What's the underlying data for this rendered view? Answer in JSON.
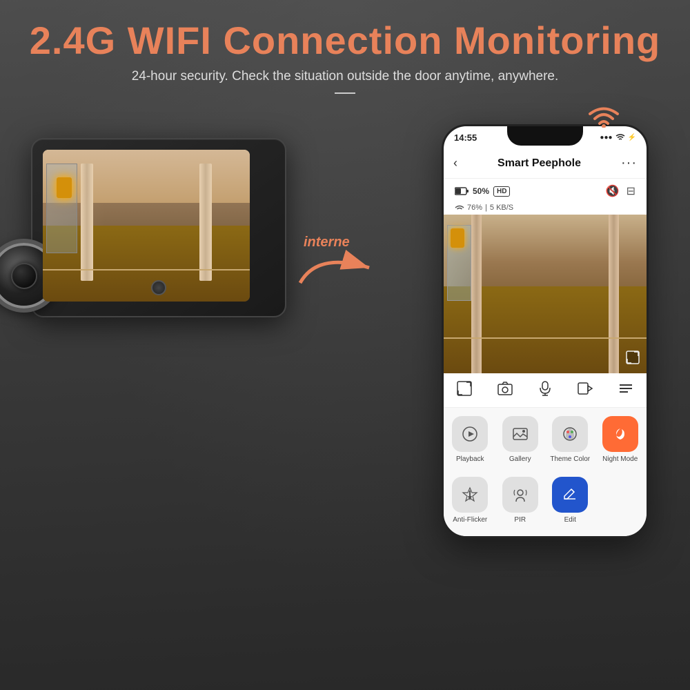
{
  "header": {
    "main_title": "2.4G WIFI Connection Monitoring",
    "sub_title": "24-hour security. Check the situation outside the door anytime, anywhere."
  },
  "arrow": {
    "label": "interne"
  },
  "phone": {
    "status_bar": {
      "time": "14:55",
      "signal": "●●●",
      "wifi": "WiFi",
      "battery": "⚡"
    },
    "nav": {
      "back": "‹",
      "title": "Smart Peephole",
      "more": "···"
    },
    "device_info": {
      "battery_pct": "50%",
      "hd_label": "HD",
      "signal_pct": "76%",
      "speed": "5 KB/S"
    },
    "controls": {
      "fullscreen": "⛶",
      "camera": "📷",
      "mic": "🎙",
      "video": "▶",
      "menu": "≡"
    },
    "menu_items": [
      {
        "id": "playback",
        "label": "Playback",
        "icon": "▶",
        "color": "gray"
      },
      {
        "id": "gallery",
        "label": "Gallery",
        "icon": "🖼",
        "color": "gray"
      },
      {
        "id": "theme-color",
        "label": "Theme Color",
        "icon": "🎨",
        "color": "gray"
      },
      {
        "id": "night-mode",
        "label": "Night Mode",
        "icon": "☾",
        "color": "orange"
      },
      {
        "id": "anti-flicker",
        "label": "Anti-Flicker",
        "icon": "⚡",
        "color": "gray"
      },
      {
        "id": "pir",
        "label": "PIR",
        "icon": "👁",
        "color": "gray"
      },
      {
        "id": "edit",
        "label": "Edit",
        "icon": "✎",
        "color": "blue-dark"
      }
    ]
  }
}
